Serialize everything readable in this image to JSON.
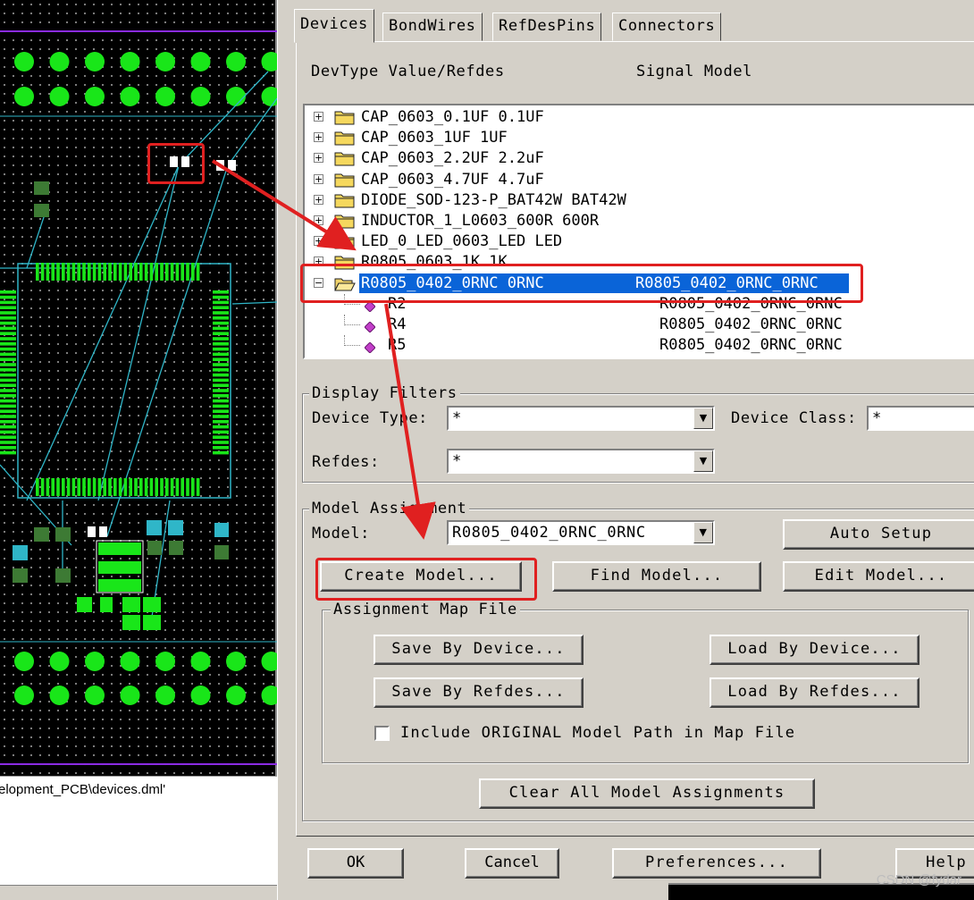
{
  "pcb": {
    "status_path": "elopment_PCB\\devices.dml'"
  },
  "dialog": {
    "tabs": [
      "Devices",
      "BondWires",
      "RefDesPins",
      "Connectors"
    ],
    "columns": {
      "devtype": "DevType Value/Refdes",
      "signal_model": "Signal Model"
    },
    "tree": [
      {
        "label": "CAP_0603_0.1UF 0.1UF",
        "expander": "+"
      },
      {
        "label": "CAP_0603_1UF 1UF",
        "expander": "+"
      },
      {
        "label": "CAP_0603_2.2UF 2.2uF",
        "expander": "+"
      },
      {
        "label": "CAP_0603_4.7UF 4.7uF",
        "expander": "+"
      },
      {
        "label": "DIODE_SOD-123-P_BAT42W BAT42W",
        "expander": "+"
      },
      {
        "label": "INDUCTOR_1_L0603_600R 600R",
        "expander": "+"
      },
      {
        "label": "LED_0_LED_0603_LED LED",
        "expander": "+"
      },
      {
        "label": "R0805_0603_1K 1K",
        "expander": "+"
      },
      {
        "label": "R0805_0402_0RNC 0RNC",
        "signal": "R0805_0402_0RNC_0RNC",
        "expander": "-",
        "selected": true
      },
      {
        "label": "R2",
        "signal": "R0805_0402_0RNC_0RNC",
        "leaf": true
      },
      {
        "label": "R4",
        "signal": "R0805_0402_0RNC_0RNC",
        "leaf": true
      },
      {
        "label": "R5",
        "signal": "R0805_0402_0RNC_0RNC",
        "leaf": true
      }
    ],
    "display_filters": {
      "title": "Display Filters",
      "device_type_label": "Device Type:",
      "device_type_value": "*",
      "device_class_label": "Device Class:",
      "device_class_value": "*",
      "refdes_label": "Refdes:",
      "refdes_value": "*"
    },
    "model_assignment": {
      "title": "Model Assignment",
      "model_label": "Model:",
      "model_value": "R0805_0402_0RNC_0RNC",
      "auto_setup": "Auto Setup",
      "create_model": "Create Model...",
      "find_model": "Find Model...",
      "edit_model": "Edit Model..."
    },
    "assignment_map": {
      "title": "Assignment Map File",
      "save_by_device": "Save By Device...",
      "load_by_device": "Load By Device...",
      "save_by_refdes": "Save By Refdes...",
      "load_by_refdes": "Load By Refdes...",
      "include_original": "Include ORIGINAL Model Path in Map File",
      "include_original_checked": false
    },
    "clear_all": "Clear All Model Assignments",
    "footer": {
      "ok": "OK",
      "cancel": "Cancel",
      "preferences": "Preferences...",
      "help": "Help"
    }
  },
  "colors": {
    "selection": "#0a64d8",
    "annotation_red": "#e02020",
    "pad_green": "#19e619",
    "trace_cyan": "#2fb6c8"
  },
  "watermark": "CSDN @fydar"
}
